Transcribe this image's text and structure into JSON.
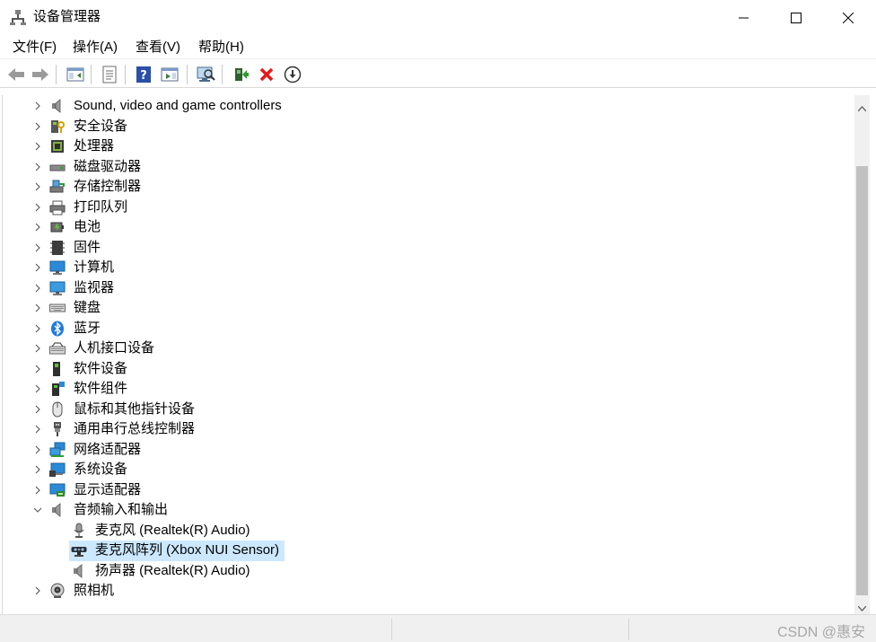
{
  "window": {
    "title": "设备管理器",
    "icon": "device-manager-icon"
  },
  "menubar": {
    "items": [
      "文件(F)",
      "操作(A)",
      "查看(V)",
      "帮助(H)"
    ]
  },
  "toolbar": {
    "buttons": [
      "back-arrow-icon",
      "forward-arrow-icon",
      "show-hide-console-tree-icon",
      "properties-icon",
      "help-icon",
      "action-pane-icon",
      "scan-hardware-icon",
      "update-driver-icon",
      "uninstall-device-icon",
      "disable-device-icon"
    ]
  },
  "tree": {
    "items": [
      {
        "label": "Sound, video and game controllers",
        "icon": "speaker-icon",
        "state": "collapsed"
      },
      {
        "label": "安全设备",
        "icon": "security-key-icon",
        "state": "collapsed"
      },
      {
        "label": "处理器",
        "icon": "processor-chip-icon",
        "state": "collapsed"
      },
      {
        "label": "磁盘驱动器",
        "icon": "disk-drive-icon",
        "state": "collapsed"
      },
      {
        "label": "存储控制器",
        "icon": "storage-controller-icon",
        "state": "collapsed"
      },
      {
        "label": "打印队列",
        "icon": "printer-icon",
        "state": "collapsed"
      },
      {
        "label": "电池",
        "icon": "battery-icon",
        "state": "collapsed"
      },
      {
        "label": "固件",
        "icon": "firmware-icon",
        "state": "collapsed"
      },
      {
        "label": "计算机",
        "icon": "computer-monitor-icon",
        "state": "collapsed"
      },
      {
        "label": "监视器",
        "icon": "monitor-icon",
        "state": "collapsed"
      },
      {
        "label": "键盘",
        "icon": "keyboard-icon",
        "state": "collapsed"
      },
      {
        "label": "蓝牙",
        "icon": "bluetooth-icon",
        "state": "collapsed"
      },
      {
        "label": "人机接口设备",
        "icon": "hid-icon",
        "state": "collapsed"
      },
      {
        "label": "软件设备",
        "icon": "software-device-icon",
        "state": "collapsed"
      },
      {
        "label": "软件组件",
        "icon": "software-component-icon",
        "state": "collapsed"
      },
      {
        "label": "鼠标和其他指针设备",
        "icon": "mouse-icon",
        "state": "collapsed"
      },
      {
        "label": "通用串行总线控制器",
        "icon": "usb-icon",
        "state": "collapsed"
      },
      {
        "label": "网络适配器",
        "icon": "network-adapter-icon",
        "state": "collapsed"
      },
      {
        "label": "系统设备",
        "icon": "system-device-icon",
        "state": "collapsed"
      },
      {
        "label": "显示适配器",
        "icon": "display-adapter-icon",
        "state": "collapsed"
      },
      {
        "label": "音频输入和输出",
        "icon": "speaker-icon",
        "state": "expanded"
      },
      {
        "label": "麦克风 (Realtek(R) Audio)",
        "icon": "microphone-icon",
        "state": "child"
      },
      {
        "label": "麦克风阵列 (Xbox NUI Sensor)",
        "icon": "kinect-sensor-icon",
        "state": "child-selected"
      },
      {
        "label": "扬声器 (Realtek(R) Audio)",
        "icon": "speaker-icon",
        "state": "child"
      },
      {
        "label": "照相机",
        "icon": "camera-icon",
        "state": "collapsed"
      }
    ]
  },
  "statusbar": {
    "watermark": "CSDN @惠安"
  },
  "colors": {
    "selection": "#cce8ff",
    "scrollbar_track": "#f0f0f0",
    "scrollbar_thumb": "#c1c1c1"
  }
}
